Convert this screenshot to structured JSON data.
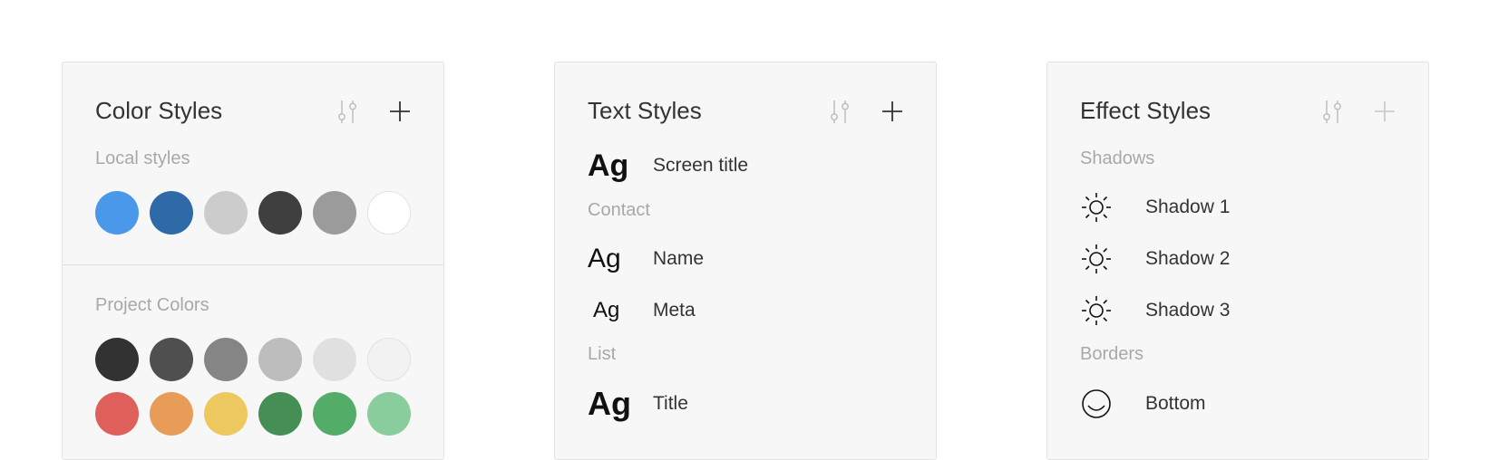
{
  "colors": {
    "panel_bg": "#f7f7f7",
    "section_label": "#a8a8a8",
    "title": "#333333",
    "icon_active": "#333333",
    "icon_muted": "#bdbdbd"
  },
  "color_panel": {
    "title": "Color Styles",
    "adjust_icon": "sliders-icon",
    "add_icon": "plus-icon",
    "local_label": "Local styles",
    "local_swatches": [
      "#4a98ea",
      "#2f6aa8",
      "#cccccc",
      "#3f3f3f",
      "#9b9b9b",
      "#ffffff"
    ],
    "project_label": "Project Colors",
    "project_row1": [
      "#323232",
      "#4f4f4f",
      "#858585",
      "#bdbdbd",
      "#e0e0e0",
      "#f2f2f2"
    ],
    "project_row2": [
      "#df605b",
      "#e79c57",
      "#edc85f",
      "#458f57",
      "#53ac68",
      "#89cd9d"
    ]
  },
  "text_panel": {
    "title": "Text Styles",
    "adjust_icon": "sliders-icon",
    "add_icon": "plus-icon",
    "preview": "Ag",
    "items": [
      {
        "label": "Screen title"
      },
      {
        "section": "Contact"
      },
      {
        "label": "Name"
      },
      {
        "label": "Meta"
      },
      {
        "section": "List"
      },
      {
        "label": "Title"
      }
    ]
  },
  "effect_panel": {
    "title": "Effect Styles",
    "adjust_icon": "sliders-icon",
    "add_icon": "plus-icon",
    "shadows_label": "Shadows",
    "shadows": [
      {
        "label": "Shadow 1",
        "icon": "sun-icon"
      },
      {
        "label": "Shadow 2",
        "icon": "sun-icon"
      },
      {
        "label": "Shadow 3",
        "icon": "sun-icon"
      }
    ],
    "borders_label": "Borders",
    "borders": [
      {
        "label": "Bottom",
        "icon": "smile-circle-icon"
      }
    ]
  }
}
